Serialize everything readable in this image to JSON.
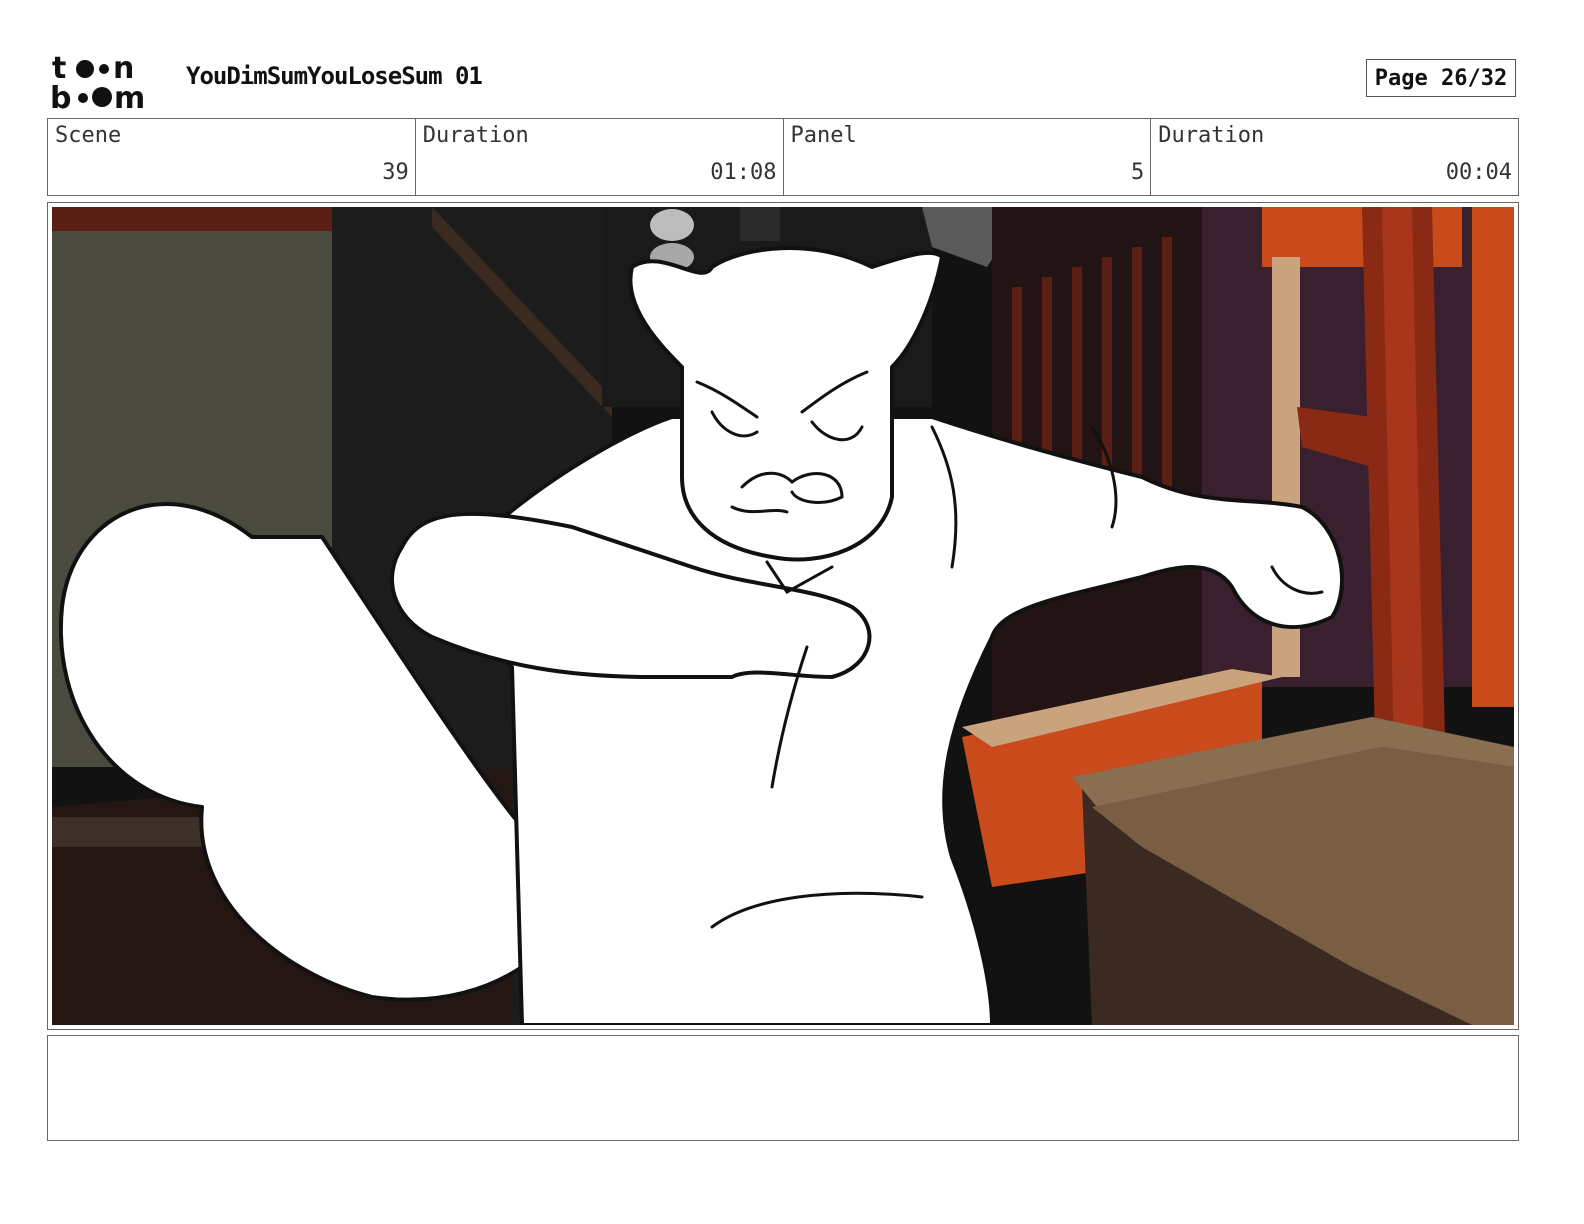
{
  "header": {
    "logo_text_top": "toon",
    "logo_text_bottom": "boom",
    "project_title": "YouDimSumYouLoseSum 01",
    "page_label": "Page 26/32"
  },
  "info": {
    "scene_label": "Scene",
    "scene_value": "39",
    "scene_duration_label": "Duration",
    "scene_duration_value": "01:08",
    "panel_label": "Panel",
    "panel_value": "5",
    "panel_duration_label": "Duration",
    "panel_duration_value": "00:04"
  },
  "panel": {
    "image_description_icon": "storyboard-panel-image",
    "colors": {
      "dark": "#121212",
      "orange": "#c94a1a",
      "purple": "#3a1f2e",
      "tan": "#c9a27e",
      "olive": "#4a4a3e",
      "brown": "#8a6e52"
    }
  },
  "caption": {
    "text": ""
  }
}
